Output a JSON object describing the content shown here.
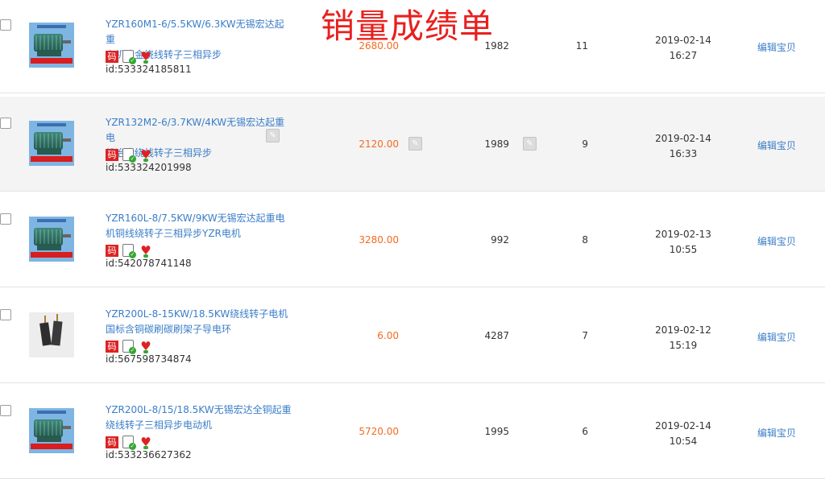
{
  "overlay_title": "销量成绩单",
  "badges": {
    "code_label": "码",
    "phone_check": "✓",
    "heart": "♥"
  },
  "colors": {
    "link": "#3b7ec8",
    "price": "#f26b1f",
    "overlay": "#e8201e",
    "row_alt": "#f4f4f4"
  },
  "rows": [
    {
      "title_line1": "YZR160M1-6/5.5KW/6.3KW无锡宏达起重",
      "title_line2": "电机冶金绕线转子三相异步",
      "item_id": "id:533324185811",
      "price": "2680.00",
      "stock": "1982",
      "sales": "11",
      "date": "2019-02-14",
      "time": "16:27",
      "edit_label": "编辑宝贝",
      "thumb": "motor-image",
      "pencil_icons": false
    },
    {
      "title_line1": "YZR132M2-6/3.7KW/4KW无锡宏达起重电",
      "title_line2": "机冶金绕线转子三相异步",
      "item_id": "id:533324201998",
      "price": "2120.00",
      "stock": "1989",
      "sales": "9",
      "date": "2019-02-14",
      "time": "16:33",
      "edit_label": "编辑宝贝",
      "thumb": "motor-image",
      "pencil_icons": true
    },
    {
      "title_line1": "YZR160L-8/7.5KW/9KW无锡宏达起重电",
      "title_line2": "机铜线绕转子三相异步YZR电机",
      "item_id": "id:542078741148",
      "price": "3280.00",
      "stock": "992",
      "sales": "8",
      "date": "2019-02-13",
      "time": "10:55",
      "edit_label": "编辑宝贝",
      "thumb": "motor-image",
      "pencil_icons": false
    },
    {
      "title_line1": "YZR200L-8-15KW/18.5KW绕线转子电机",
      "title_line2": "国标含铜碳刷碳刷架子导电环",
      "item_id": "id:567598734874",
      "price": "6.00",
      "stock": "4287",
      "sales": "7",
      "date": "2019-02-12",
      "time": "15:19",
      "edit_label": "编辑宝贝",
      "thumb": "carbon-brush-image",
      "pencil_icons": false
    },
    {
      "title_line1": "YZR200L-8/15/18.5KW无锡宏达全铜起重",
      "title_line2": "绕线转子三相异步电动机",
      "item_id": "id:533236627362",
      "price": "5720.00",
      "stock": "1995",
      "sales": "6",
      "date": "2019-02-14",
      "time": "10:54",
      "edit_label": "编辑宝贝",
      "thumb": "motor-image",
      "pencil_icons": false
    }
  ]
}
